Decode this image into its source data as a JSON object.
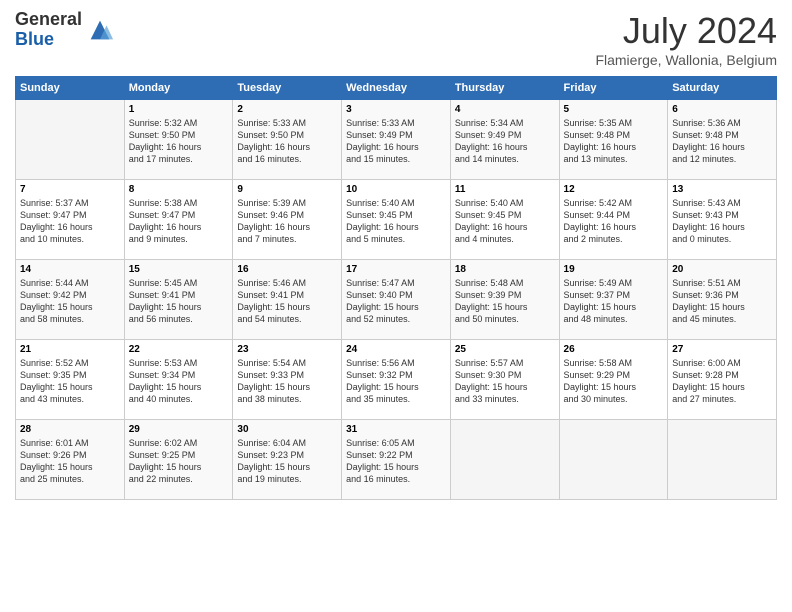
{
  "header": {
    "logo_general": "General",
    "logo_blue": "Blue",
    "title": "July 2024",
    "location": "Flamierge, Wallonia, Belgium"
  },
  "weekdays": [
    "Sunday",
    "Monday",
    "Tuesday",
    "Wednesday",
    "Thursday",
    "Friday",
    "Saturday"
  ],
  "weeks": [
    [
      {
        "day": "",
        "info": ""
      },
      {
        "day": "1",
        "info": "Sunrise: 5:32 AM\nSunset: 9:50 PM\nDaylight: 16 hours\nand 17 minutes."
      },
      {
        "day": "2",
        "info": "Sunrise: 5:33 AM\nSunset: 9:50 PM\nDaylight: 16 hours\nand 16 minutes."
      },
      {
        "day": "3",
        "info": "Sunrise: 5:33 AM\nSunset: 9:49 PM\nDaylight: 16 hours\nand 15 minutes."
      },
      {
        "day": "4",
        "info": "Sunrise: 5:34 AM\nSunset: 9:49 PM\nDaylight: 16 hours\nand 14 minutes."
      },
      {
        "day": "5",
        "info": "Sunrise: 5:35 AM\nSunset: 9:48 PM\nDaylight: 16 hours\nand 13 minutes."
      },
      {
        "day": "6",
        "info": "Sunrise: 5:36 AM\nSunset: 9:48 PM\nDaylight: 16 hours\nand 12 minutes."
      }
    ],
    [
      {
        "day": "7",
        "info": "Sunrise: 5:37 AM\nSunset: 9:47 PM\nDaylight: 16 hours\nand 10 minutes."
      },
      {
        "day": "8",
        "info": "Sunrise: 5:38 AM\nSunset: 9:47 PM\nDaylight: 16 hours\nand 9 minutes."
      },
      {
        "day": "9",
        "info": "Sunrise: 5:39 AM\nSunset: 9:46 PM\nDaylight: 16 hours\nand 7 minutes."
      },
      {
        "day": "10",
        "info": "Sunrise: 5:40 AM\nSunset: 9:45 PM\nDaylight: 16 hours\nand 5 minutes."
      },
      {
        "day": "11",
        "info": "Sunrise: 5:40 AM\nSunset: 9:45 PM\nDaylight: 16 hours\nand 4 minutes."
      },
      {
        "day": "12",
        "info": "Sunrise: 5:42 AM\nSunset: 9:44 PM\nDaylight: 16 hours\nand 2 minutes."
      },
      {
        "day": "13",
        "info": "Sunrise: 5:43 AM\nSunset: 9:43 PM\nDaylight: 16 hours\nand 0 minutes."
      }
    ],
    [
      {
        "day": "14",
        "info": "Sunrise: 5:44 AM\nSunset: 9:42 PM\nDaylight: 15 hours\nand 58 minutes."
      },
      {
        "day": "15",
        "info": "Sunrise: 5:45 AM\nSunset: 9:41 PM\nDaylight: 15 hours\nand 56 minutes."
      },
      {
        "day": "16",
        "info": "Sunrise: 5:46 AM\nSunset: 9:41 PM\nDaylight: 15 hours\nand 54 minutes."
      },
      {
        "day": "17",
        "info": "Sunrise: 5:47 AM\nSunset: 9:40 PM\nDaylight: 15 hours\nand 52 minutes."
      },
      {
        "day": "18",
        "info": "Sunrise: 5:48 AM\nSunset: 9:39 PM\nDaylight: 15 hours\nand 50 minutes."
      },
      {
        "day": "19",
        "info": "Sunrise: 5:49 AM\nSunset: 9:37 PM\nDaylight: 15 hours\nand 48 minutes."
      },
      {
        "day": "20",
        "info": "Sunrise: 5:51 AM\nSunset: 9:36 PM\nDaylight: 15 hours\nand 45 minutes."
      }
    ],
    [
      {
        "day": "21",
        "info": "Sunrise: 5:52 AM\nSunset: 9:35 PM\nDaylight: 15 hours\nand 43 minutes."
      },
      {
        "day": "22",
        "info": "Sunrise: 5:53 AM\nSunset: 9:34 PM\nDaylight: 15 hours\nand 40 minutes."
      },
      {
        "day": "23",
        "info": "Sunrise: 5:54 AM\nSunset: 9:33 PM\nDaylight: 15 hours\nand 38 minutes."
      },
      {
        "day": "24",
        "info": "Sunrise: 5:56 AM\nSunset: 9:32 PM\nDaylight: 15 hours\nand 35 minutes."
      },
      {
        "day": "25",
        "info": "Sunrise: 5:57 AM\nSunset: 9:30 PM\nDaylight: 15 hours\nand 33 minutes."
      },
      {
        "day": "26",
        "info": "Sunrise: 5:58 AM\nSunset: 9:29 PM\nDaylight: 15 hours\nand 30 minutes."
      },
      {
        "day": "27",
        "info": "Sunrise: 6:00 AM\nSunset: 9:28 PM\nDaylight: 15 hours\nand 27 minutes."
      }
    ],
    [
      {
        "day": "28",
        "info": "Sunrise: 6:01 AM\nSunset: 9:26 PM\nDaylight: 15 hours\nand 25 minutes."
      },
      {
        "day": "29",
        "info": "Sunrise: 6:02 AM\nSunset: 9:25 PM\nDaylight: 15 hours\nand 22 minutes."
      },
      {
        "day": "30",
        "info": "Sunrise: 6:04 AM\nSunset: 9:23 PM\nDaylight: 15 hours\nand 19 minutes."
      },
      {
        "day": "31",
        "info": "Sunrise: 6:05 AM\nSunset: 9:22 PM\nDaylight: 15 hours\nand 16 minutes."
      },
      {
        "day": "",
        "info": ""
      },
      {
        "day": "",
        "info": ""
      },
      {
        "day": "",
        "info": ""
      }
    ]
  ]
}
